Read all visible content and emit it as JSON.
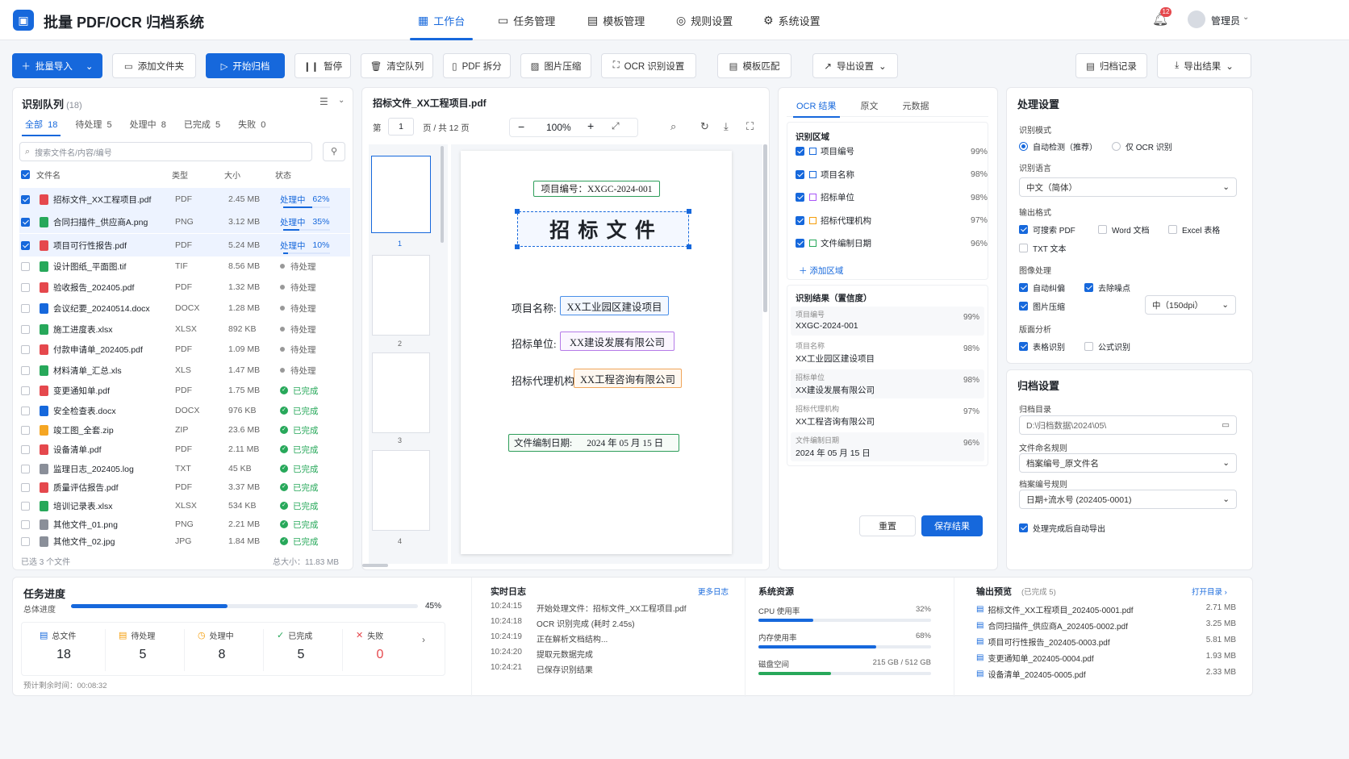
{
  "app": {
    "title": "批量 PDF/OCR 归档系统",
    "logo_icon": "folder-logo-icon"
  },
  "nav": [
    {
      "label": "工作台",
      "icon": "grid-icon"
    },
    {
      "label": "任务管理",
      "icon": "briefcase-icon"
    },
    {
      "label": "模板管理",
      "icon": "template-icon"
    },
    {
      "label": "规则设置",
      "icon": "check-circle-icon"
    },
    {
      "label": "系统设置",
      "icon": "gear-icon"
    }
  ],
  "header": {
    "notif_count": "12",
    "user": "管理员"
  },
  "toolbar": {
    "import": "批量导入",
    "add_folder": "添加文件夹",
    "start": "开始归档",
    "pause": "暂停",
    "clear": "清空队列",
    "split": "PDF 拆分",
    "compress": "图片压缩",
    "ocr_settings": "OCR 识别设置",
    "template_match": "模板匹配",
    "export_settings": "导出设置",
    "archive_log": "归档记录",
    "export_results": "导出结果"
  },
  "queue": {
    "title": "识别队列",
    "count": "(18)",
    "tabs": [
      {
        "label": "全部",
        "n": "18"
      },
      {
        "label": "待处理",
        "n": "5"
      },
      {
        "label": "处理中",
        "n": "8"
      },
      {
        "label": "已完成",
        "n": "5"
      },
      {
        "label": "失败",
        "n": "0"
      }
    ],
    "search_placeholder": "搜索文件名/内容/编号",
    "cols": [
      "文件名",
      "类型",
      "大小",
      "状态"
    ],
    "rows": [
      {
        "name": "招标文件_XX工程项目.pdf",
        "type": "PDF",
        "size": "2.45 MB",
        "status": "处理中",
        "pct": "62%",
        "state": "proc",
        "checked": true,
        "color": "#e5484d"
      },
      {
        "name": "合同扫描件_供应商A.png",
        "type": "PNG",
        "size": "3.12 MB",
        "status": "处理中",
        "pct": "35%",
        "state": "proc",
        "checked": true,
        "color": "#27a85a"
      },
      {
        "name": "项目可行性报告.pdf",
        "type": "PDF",
        "size": "5.24 MB",
        "status": "处理中",
        "pct": "10%",
        "state": "proc",
        "checked": true,
        "color": "#e5484d"
      },
      {
        "name": "设计图纸_平面图.tif",
        "type": "TIF",
        "size": "8.56 MB",
        "status": "待处理",
        "pct": "",
        "state": "wait",
        "checked": false,
        "color": "#27a85a"
      },
      {
        "name": "验收报告_202405.pdf",
        "type": "PDF",
        "size": "1.32 MB",
        "status": "待处理",
        "pct": "",
        "state": "wait",
        "checked": false,
        "color": "#e5484d"
      },
      {
        "name": "会议纪要_20240514.docx",
        "type": "DOCX",
        "size": "1.28 MB",
        "status": "待处理",
        "pct": "",
        "state": "wait",
        "checked": false,
        "color": "#1668dc"
      },
      {
        "name": "施工进度表.xlsx",
        "type": "XLSX",
        "size": "892 KB",
        "status": "待处理",
        "pct": "",
        "state": "wait",
        "checked": false,
        "color": "#27a85a"
      },
      {
        "name": "付款申请单_202405.pdf",
        "type": "PDF",
        "size": "1.09 MB",
        "status": "待处理",
        "pct": "",
        "state": "wait",
        "checked": false,
        "color": "#e5484d"
      },
      {
        "name": "材料清单_汇总.xls",
        "type": "XLS",
        "size": "1.47 MB",
        "status": "待处理",
        "pct": "",
        "state": "wait",
        "checked": false,
        "color": "#27a85a"
      },
      {
        "name": "变更通知单.pdf",
        "type": "PDF",
        "size": "1.75 MB",
        "status": "已完成",
        "pct": "",
        "state": "done",
        "checked": false,
        "color": "#e5484d"
      },
      {
        "name": "安全检查表.docx",
        "type": "DOCX",
        "size": "976 KB",
        "status": "已完成",
        "pct": "",
        "state": "done",
        "checked": false,
        "color": "#1668dc"
      },
      {
        "name": "竣工图_全套.zip",
        "type": "ZIP",
        "size": "23.6 MB",
        "status": "已完成",
        "pct": "",
        "state": "done",
        "checked": false,
        "color": "#f5a623"
      },
      {
        "name": "设备清单.pdf",
        "type": "PDF",
        "size": "2.11 MB",
        "status": "已完成",
        "pct": "",
        "state": "done",
        "checked": false,
        "color": "#e5484d"
      },
      {
        "name": "监理日志_202405.log",
        "type": "TXT",
        "size": "45 KB",
        "status": "已完成",
        "pct": "",
        "state": "done",
        "checked": false,
        "color": "#8a8f99"
      },
      {
        "name": "质量评估报告.pdf",
        "type": "PDF",
        "size": "3.37 MB",
        "status": "已完成",
        "pct": "",
        "state": "done",
        "checked": false,
        "color": "#e5484d"
      },
      {
        "name": "培训记录表.xlsx",
        "type": "XLSX",
        "size": "534 KB",
        "status": "已完成",
        "pct": "",
        "state": "done",
        "checked": false,
        "color": "#27a85a"
      },
      {
        "name": "其他文件_01.png",
        "type": "PNG",
        "size": "2.21 MB",
        "status": "已完成",
        "pct": "",
        "state": "done",
        "checked": false,
        "color": "#8a8f99"
      },
      {
        "name": "其他文件_02.jpg",
        "type": "JPG",
        "size": "1.84 MB",
        "status": "已完成",
        "pct": "",
        "state": "done",
        "checked": false,
        "color": "#8a8f99"
      }
    ],
    "footer_left": "已选 3 个文件",
    "footer_right": "总大小：11.83 MB"
  },
  "viewer": {
    "filename": "招标文件_XX工程项目.pdf",
    "page_label": "第",
    "page": "1",
    "of": "页 / 共 12 页",
    "zoom": "100%",
    "thumbs": [
      "1",
      "2",
      "3",
      "4"
    ],
    "doc": {
      "code": "项目编号：XXGC-2024-001",
      "title": "招 标 文 件",
      "name_label": "项目名称:",
      "name_value": "XX工业园区建设项目",
      "unit_label": "招标单位:",
      "unit_value": "XX建设发展有限公司",
      "agent_label": "招标代理机构:",
      "agent_value": "XX工程咨询有限公司",
      "date_label": "文件编制日期:",
      "date_value": "2024 年 05 月 15 日"
    }
  },
  "ocr": {
    "tabs": [
      "OCR 结果",
      "原文",
      "元数据"
    ],
    "region_title": "识别区域",
    "regions": [
      {
        "name": "项目编号",
        "conf": "99%",
        "color": "#1668dc"
      },
      {
        "name": "项目名称",
        "conf": "98%",
        "color": "#1668dc"
      },
      {
        "name": "招标单位",
        "conf": "98%",
        "color": "#a855f7"
      },
      {
        "name": "招标代理机构",
        "conf": "97%",
        "color": "#f59e0b"
      },
      {
        "name": "文件编制日期",
        "conf": "96%",
        "color": "#27a85a"
      }
    ],
    "add_region": "添加区域",
    "result_title": "识别结果（置信度）",
    "results": [
      {
        "k": "项目编号",
        "v": "XXGC-2024-001",
        "c": "99%"
      },
      {
        "k": "项目名称",
        "v": "XX工业园区建设项目",
        "c": "98%"
      },
      {
        "k": "招标单位",
        "v": "XX建设发展有限公司",
        "c": "98%"
      },
      {
        "k": "招标代理机构",
        "v": "XX工程咨询有限公司",
        "c": "97%"
      },
      {
        "k": "文件编制日期",
        "v": "2024 年 05 月 15 日",
        "c": "96%"
      }
    ],
    "reset": "重置",
    "save": "保存结果"
  },
  "settings": {
    "title": "处理设置",
    "mode_label": "识别模式",
    "mode_auto": "自动检测（推荐）",
    "mode_ocr": "仅 OCR 识别",
    "lang_label": "识别语言",
    "lang": "中文（简体）",
    "format_label": "输出格式",
    "fmt_pdf": "可搜索 PDF",
    "fmt_word": "Word 文档",
    "fmt_excel": "Excel 表格",
    "fmt_txt": "TXT 文本",
    "img_label": "图像处理",
    "img_deskew": "自动纠偏",
    "img_denoise": "去除噪点",
    "img_compress": "图片压缩",
    "img_dpi": "中（150dpi）",
    "layout_label": "版面分析",
    "layout_table": "表格识别",
    "layout_formula": "公式识别"
  },
  "archive": {
    "title": "归档设置",
    "dir_label": "归档目录",
    "dir": "D:\\归档数据\\2024\\05\\",
    "naming_label": "文件命名规则",
    "naming": "档案编号_原文件名",
    "code_label": "档案编号规则",
    "code": "日期+流水号 (202405-0001)",
    "auto_export": "处理完成后自动导出"
  },
  "progress": {
    "title": "任务进度",
    "overall_label": "总体进度",
    "overall": "45%",
    "overall_frac": 0.45,
    "stats": [
      {
        "label": "总文件",
        "n": "18",
        "color": "#1668dc"
      },
      {
        "label": "待处理",
        "n": "5",
        "color": "#f59e0b"
      },
      {
        "label": "处理中",
        "n": "8",
        "color": "#f59e0b"
      },
      {
        "label": "已完成",
        "n": "5",
        "color": "#27a85a"
      },
      {
        "label": "失败",
        "n": "0",
        "color": "#e5484d"
      }
    ],
    "eta": "预计剩余时间：00:08:32"
  },
  "log": {
    "title": "实时日志",
    "more": "更多日志",
    "lines": [
      {
        "t": "10:24:15",
        "m": "开始处理文件：招标文件_XX工程项目.pdf"
      },
      {
        "t": "10:24:18",
        "m": "OCR 识别完成 (耗时 2.45s)"
      },
      {
        "t": "10:24:19",
        "m": "正在解析文档结构..."
      },
      {
        "t": "10:24:20",
        "m": "提取元数据完成"
      },
      {
        "t": "10:24:21",
        "m": "已保存识别结果"
      }
    ]
  },
  "resources": {
    "title": "系统资源",
    "items": [
      {
        "label": "CPU 使用率",
        "value": "32%",
        "frac": 0.32,
        "color": "#1668dc"
      },
      {
        "label": "内存使用率",
        "value": "68%",
        "frac": 0.68,
        "color": "#1668dc"
      },
      {
        "label": "磁盘空间",
        "value": "215 GB / 512 GB",
        "frac": 0.42,
        "color": "#27a85a"
      }
    ]
  },
  "output": {
    "title": "输出预览",
    "sub": "(已完成 5)",
    "open": "打开目录",
    "files": [
      {
        "n": "招标文件_XX工程项目_202405-0001.pdf",
        "s": "2.71 MB"
      },
      {
        "n": "合同扫描件_供应商A_202405-0002.pdf",
        "s": "3.25 MB"
      },
      {
        "n": "项目可行性报告_202405-0003.pdf",
        "s": "5.81 MB"
      },
      {
        "n": "变更通知单_202405-0004.pdf",
        "s": "1.93 MB"
      },
      {
        "n": "设备清单_202405-0005.pdf",
        "s": "2.33 MB"
      }
    ]
  }
}
